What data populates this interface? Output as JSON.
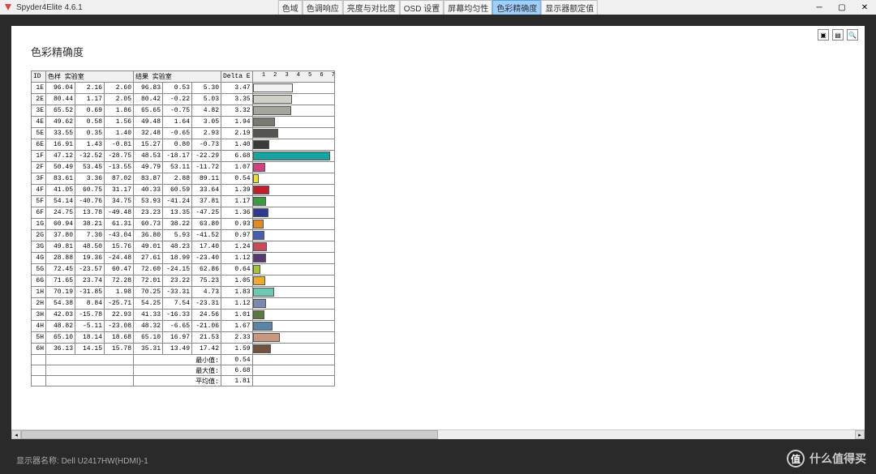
{
  "app": {
    "title": "Spyder4Elite 4.6.1"
  },
  "tabs": [
    {
      "label": "色域",
      "active": false
    },
    {
      "label": "色调响应",
      "active": false
    },
    {
      "label": "亮度与对比度",
      "active": false
    },
    {
      "label": "OSD 设置",
      "active": false
    },
    {
      "label": "屏幕均匀性",
      "active": false
    },
    {
      "label": "色彩精确度",
      "active": true
    },
    {
      "label": "显示器额定值",
      "active": false
    }
  ],
  "page": {
    "title": "色彩精确度",
    "headers": {
      "id": "ID",
      "sample": "色样 实验室",
      "result": "结果 实验室",
      "delta": "Delta E"
    },
    "axis_ticks": [
      "1",
      "2",
      "3",
      "4",
      "5",
      "6",
      "7"
    ],
    "rows": [
      {
        "id": "1E",
        "s": [
          96.04,
          2.16,
          2.6
        ],
        "r": [
          96.83,
          0.53,
          5.3
        ],
        "d": 3.47,
        "color": "#f2f2f0"
      },
      {
        "id": "2E",
        "s": [
          80.44,
          1.17,
          2.05
        ],
        "r": [
          80.42,
          -0.22,
          5.03
        ],
        "d": 3.35,
        "color": "#d0d0c9"
      },
      {
        "id": "3E",
        "s": [
          65.52,
          0.69,
          1.86
        ],
        "r": [
          65.65,
          -0.75,
          4.82
        ],
        "d": 3.32,
        "color": "#a5a59e"
      },
      {
        "id": "4E",
        "s": [
          49.62,
          0.58,
          1.56
        ],
        "r": [
          49.48,
          1.64,
          3.05
        ],
        "d": 1.94,
        "color": "#797972"
      },
      {
        "id": "5E",
        "s": [
          33.55,
          0.35,
          1.4
        ],
        "r": [
          32.48,
          -0.65,
          2.93
        ],
        "d": 2.19,
        "color": "#555550"
      },
      {
        "id": "6E",
        "s": [
          16.91,
          1.43,
          -0.81
        ],
        "r": [
          15.27,
          0.8,
          -0.73
        ],
        "d": 1.4,
        "color": "#3a3a37"
      },
      {
        "id": "1F",
        "s": [
          47.12,
          -32.52,
          -28.75
        ],
        "r": [
          48.53,
          -18.17,
          -22.29
        ],
        "d": 6.68,
        "color": "#1aa39e"
      },
      {
        "id": "2F",
        "s": [
          50.49,
          53.45,
          -13.55
        ],
        "r": [
          49.79,
          53.11,
          -11.72
        ],
        "d": 1.07,
        "color": "#d0417f"
      },
      {
        "id": "3F",
        "s": [
          83.61,
          3.36,
          87.02
        ],
        "r": [
          83.87,
          2.88,
          89.11
        ],
        "d": 0.54,
        "color": "#ede02b"
      },
      {
        "id": "4F",
        "s": [
          41.05,
          60.75,
          31.17
        ],
        "r": [
          40.33,
          60.59,
          33.64
        ],
        "d": 1.39,
        "color": "#c01f2e"
      },
      {
        "id": "5F",
        "s": [
          54.14,
          -40.76,
          34.75
        ],
        "r": [
          53.93,
          -41.24,
          37.81
        ],
        "d": 1.17,
        "color": "#3b9b42"
      },
      {
        "id": "6F",
        "s": [
          24.75,
          13.78,
          -49.48
        ],
        "r": [
          23.23,
          13.35,
          -47.25
        ],
        "d": 1.36,
        "color": "#2e3a8f"
      },
      {
        "id": "1G",
        "s": [
          60.94,
          38.21,
          61.31
        ],
        "r": [
          60.73,
          38.22,
          63.8
        ],
        "d": 0.93,
        "color": "#e08a24"
      },
      {
        "id": "2G",
        "s": [
          37.8,
          7.3,
          -43.04
        ],
        "r": [
          36.8,
          5.93,
          -41.52
        ],
        "d": 0.97,
        "color": "#4a5cb0"
      },
      {
        "id": "3G",
        "s": [
          49.81,
          48.5,
          15.76
        ],
        "r": [
          49.01,
          48.23,
          17.4
        ],
        "d": 1.24,
        "color": "#c9495b"
      },
      {
        "id": "4G",
        "s": [
          28.88,
          19.36,
          -24.48
        ],
        "r": [
          27.61,
          18.99,
          -23.4
        ],
        "d": 1.12,
        "color": "#5a3a74"
      },
      {
        "id": "5G",
        "s": [
          72.45,
          -23.57,
          60.47
        ],
        "r": [
          72.6,
          -24.15,
          62.86
        ],
        "d": 0.64,
        "color": "#a5c23b"
      },
      {
        "id": "6G",
        "s": [
          71.65,
          23.74,
          72.28
        ],
        "r": [
          72.01,
          23.22,
          75.23
        ],
        "d": 1.05,
        "color": "#ecaa2f"
      },
      {
        "id": "1H",
        "s": [
          70.19,
          -31.85,
          1.98
        ],
        "r": [
          70.25,
          -33.31,
          4.73
        ],
        "d": 1.83,
        "color": "#6ec7b3"
      },
      {
        "id": "2H",
        "s": [
          54.38,
          8.84,
          -25.71
        ],
        "r": [
          54.25,
          7.54,
          -23.31
        ],
        "d": 1.12,
        "color": "#7c88b0"
      },
      {
        "id": "3H",
        "s": [
          42.03,
          -15.78,
          22.93
        ],
        "r": [
          41.33,
          -16.33,
          24.56
        ],
        "d": 1.01,
        "color": "#5b7840"
      },
      {
        "id": "4H",
        "s": [
          48.82,
          -5.11,
          -23.08
        ],
        "r": [
          48.32,
          -6.65,
          -21.06
        ],
        "d": 1.67,
        "color": "#5d83a6"
      },
      {
        "id": "5H",
        "s": [
          65.1,
          18.14,
          18.68
        ],
        "r": [
          65.1,
          16.97,
          21.53
        ],
        "d": 2.33,
        "color": "#c99680"
      },
      {
        "id": "6H",
        "s": [
          36.13,
          14.15,
          15.78
        ],
        "r": [
          35.31,
          13.49,
          17.42
        ],
        "d": 1.59,
        "color": "#70523e"
      }
    ],
    "summary": {
      "min_label": "最小值:",
      "min_value": 0.54,
      "max_label": "最大值:",
      "max_value": 6.68,
      "avg_label": "平均值:",
      "avg_value": 1.81
    }
  },
  "footer": {
    "label": "显示器名称:",
    "value": "Dell U2417HW(HDMI)-1"
  },
  "watermark": {
    "text": "什么值得买",
    "logo": "值"
  }
}
